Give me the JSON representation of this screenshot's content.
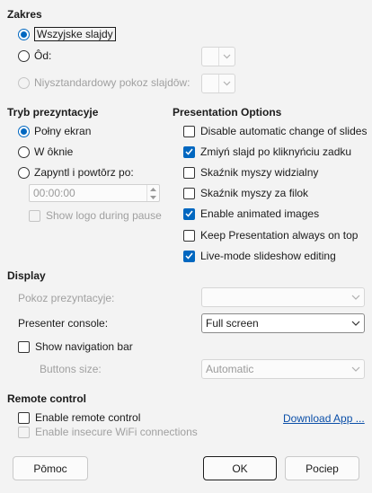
{
  "range": {
    "title": "Zakres",
    "all_slides": "Wszyjske slajdy",
    "from": "Ôd:",
    "custom_show": "Niysztandardowy pokoz slajdōw:"
  },
  "mode": {
    "title": "Tryb prezyntacyje",
    "full_screen": "Połny ekran",
    "in_window": "W ôknie",
    "loop": "Zapyntl i powtōrz po:",
    "loop_time": "00:00:00",
    "show_logo": "Show logo during pause"
  },
  "options": {
    "title": "Presentation Options",
    "items": [
      {
        "label": "Disable automatic change of slides",
        "checked": false
      },
      {
        "label": "Zmiyń slajd po kliknyńciu zadku",
        "checked": true
      },
      {
        "label": "Skaźnik myszy widzialny",
        "checked": false
      },
      {
        "label": "Skaźnik myszy za filok",
        "checked": false
      },
      {
        "label": "Enable animated images",
        "checked": true
      },
      {
        "label": "Keep Presentation always on top",
        "checked": false
      },
      {
        "label": "Live-mode slideshow editing",
        "checked": true
      }
    ]
  },
  "display": {
    "title": "Display",
    "presentation_display_label": "Pokoz prezyntacyje:",
    "presentation_display_value": "",
    "presenter_console_label": "Presenter console:",
    "presenter_console_value": "Full screen",
    "show_nav_bar": "Show navigation bar",
    "buttons_size_label": "Buttons size:",
    "buttons_size_value": "Automatic"
  },
  "remote": {
    "title": "Remote control",
    "enable_remote": "Enable remote control",
    "enable_insecure": "Enable insecure WiFi connections",
    "download_link": "Download App ..."
  },
  "buttons": {
    "help": "Pōmoc",
    "ok": "OK",
    "cancel": "Pociep"
  },
  "colors": {
    "accent": "#0067c0",
    "background": "#f3f3f3"
  }
}
